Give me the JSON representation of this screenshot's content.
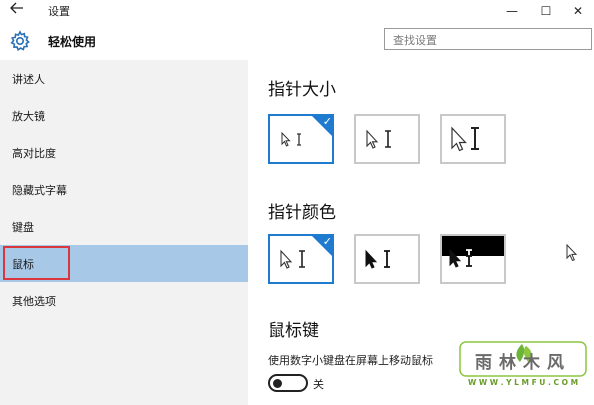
{
  "window": {
    "title": "设置",
    "back_icon": "back-arrow-icon",
    "minimize_glyph": "—",
    "maximize_glyph": "☐",
    "close_glyph": "✕"
  },
  "header": {
    "title": "轻松使用",
    "icon": "gear-icon",
    "search_placeholder": "查找设置"
  },
  "sidebar": {
    "items": [
      {
        "label": "讲述人"
      },
      {
        "label": "放大镜"
      },
      {
        "label": "高对比度"
      },
      {
        "label": "隐藏式字幕"
      },
      {
        "label": "键盘"
      },
      {
        "label": "鼠标",
        "selected": true
      },
      {
        "label": "其他选项"
      }
    ],
    "selected_color": "#a8c8e8",
    "highlight_color": "#d9363e"
  },
  "pointer_size": {
    "title": "指针大小",
    "selected_index": 0,
    "options": [
      "small",
      "medium",
      "large"
    ]
  },
  "pointer_color": {
    "title": "指针颜色",
    "selected_index": 0,
    "options": [
      "white",
      "black",
      "inverted"
    ]
  },
  "mouse_keys": {
    "title": "鼠标键",
    "description": "使用数字小键盘在屏幕上移动鼠标",
    "toggle_state": "关",
    "toggle_on": false
  },
  "watermark": {
    "line1": "雨林木风",
    "line2": "W W W . Y L M F U . C O M"
  },
  "colors": {
    "accent": "#1f7bd0",
    "sidebar_bg": "#f2f2f2"
  }
}
